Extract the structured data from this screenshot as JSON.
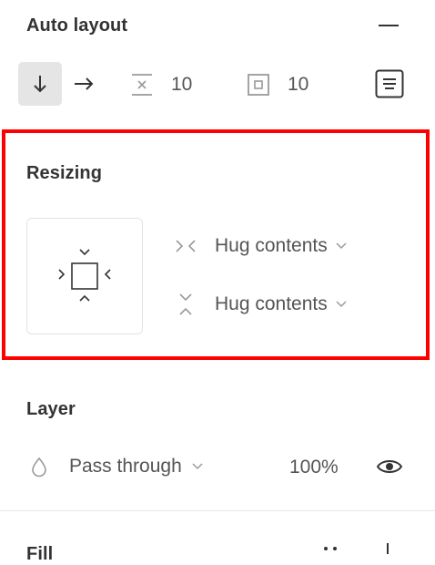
{
  "auto_layout": {
    "title": "Auto layout",
    "collapse_icon": "minus-icon",
    "direction_vertical_icon": "arrow-down-icon",
    "direction_horizontal_icon": "arrow-right-icon",
    "spacing_value": "10",
    "spacing_icon": "item-spacing-icon",
    "padding_value": "10",
    "padding_icon": "padding-icon",
    "align_icon": "alignment-icon",
    "active_direction": "vertical"
  },
  "resizing": {
    "title": "Resizing",
    "horizontal": {
      "value": "Hug contents",
      "icon": "hug-horizontal-icon"
    },
    "vertical": {
      "value": "Hug contents",
      "icon": "hug-vertical-icon"
    },
    "highlight_color": "#ff0000"
  },
  "layer": {
    "title": "Layer",
    "blend_mode": "Pass through",
    "opacity": "100%",
    "visibility_icon": "eye-icon",
    "blend_icon": "drop-icon"
  },
  "fill": {
    "title": "Fill"
  }
}
